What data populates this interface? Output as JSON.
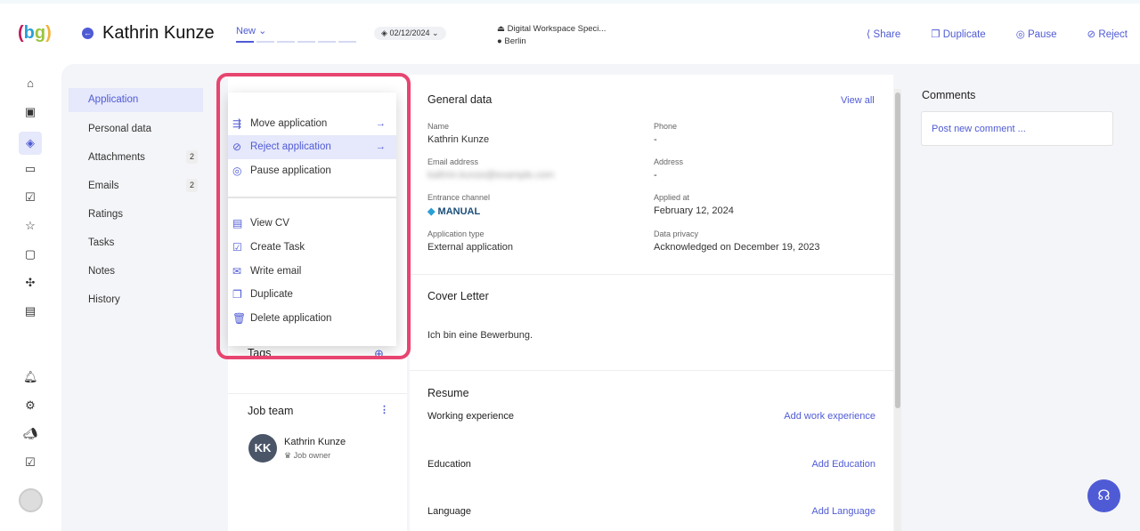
{
  "header": {
    "logo": "(bg)",
    "candidate_name": "Kathrin Kunze",
    "stage": "New",
    "stage_count": 6,
    "stage_current": 1,
    "date": "02/12/2024",
    "job_title": "Digital Workspace Speci...",
    "location": "Berlin",
    "actions": [
      "Share",
      "Duplicate",
      "Pause",
      "Reject"
    ]
  },
  "rail": [
    "home",
    "briefcase",
    "layers",
    "presentation",
    "clipboard-check",
    "star",
    "chat",
    "puzzle",
    "archive",
    "bell",
    "gear",
    "megaphone",
    "checkbox",
    "avatar"
  ],
  "nav": {
    "items": [
      {
        "label": "Application",
        "active": true
      },
      {
        "label": "Personal data"
      },
      {
        "label": "Attachments",
        "count": "2"
      },
      {
        "label": "Emails",
        "count": "2"
      },
      {
        "label": "Ratings"
      },
      {
        "label": "Tasks"
      },
      {
        "label": "Notes"
      },
      {
        "label": "History"
      }
    ]
  },
  "menu": {
    "group1": [
      {
        "label": "Move application",
        "icon": "move-icon",
        "arrow": "→"
      },
      {
        "label": "Reject application",
        "icon": "reject-icon",
        "arrow": "→",
        "highlighted": true
      },
      {
        "label": "Pause application",
        "icon": "pause-icon"
      }
    ],
    "group2": [
      {
        "label": "View CV",
        "icon": "document-icon"
      },
      {
        "label": "Create Task",
        "icon": "task-icon"
      },
      {
        "label": "Write email",
        "icon": "mail-icon"
      },
      {
        "label": "Duplicate",
        "icon": "duplicate-icon"
      },
      {
        "label": "Delete application",
        "icon": "trash-icon"
      }
    ]
  },
  "tags": {
    "title": "Tags"
  },
  "job_team": {
    "title": "Job team",
    "member": {
      "initials": "KK",
      "name": "Kathrin Kunze",
      "role": "Job owner"
    }
  },
  "general": {
    "title": "General data",
    "view_all": "View all",
    "fields": [
      {
        "label": "Name",
        "value": "Kathrin Kunze"
      },
      {
        "label": "Phone",
        "value": "-"
      },
      {
        "label": "Email address",
        "value": "kathrin.kunze@example.com"
      },
      {
        "label": "Address",
        "value": "-"
      },
      {
        "label": "Entrance channel",
        "value": "MANUAL"
      },
      {
        "label": "Applied at",
        "value": "February 12, 2024"
      },
      {
        "label": "Application type",
        "value": "External application"
      },
      {
        "label": "Data privacy",
        "value": "Acknowledged on December 19, 2023"
      }
    ]
  },
  "cover": {
    "title": "Cover Letter",
    "text": "Ich bin eine Bewerbung."
  },
  "resume": {
    "title": "Resume",
    "rows": [
      {
        "label": "Working experience",
        "action": "Add work experience"
      },
      {
        "label": "Education",
        "action": "Add Education"
      },
      {
        "label": "Language",
        "action": "Add Language"
      }
    ]
  },
  "comments": {
    "title": "Comments",
    "placeholder": "Post new comment ..."
  }
}
